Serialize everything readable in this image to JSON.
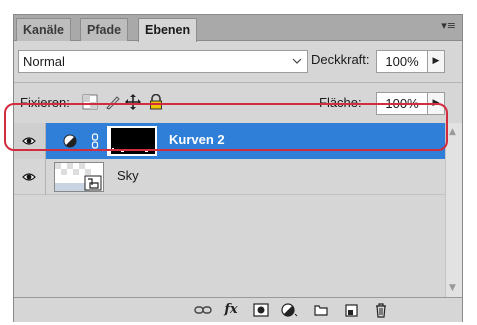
{
  "tabs": [
    {
      "label": "Kanäle"
    },
    {
      "label": "Pfade"
    },
    {
      "label": "Ebenen"
    }
  ],
  "blend_mode": {
    "value": "Normal"
  },
  "opacity": {
    "label": "Deckkraft:",
    "value": "100%"
  },
  "lock": {
    "label": "Fixieren:"
  },
  "fill": {
    "label": "Fläche:",
    "value": "100%"
  },
  "layers": [
    {
      "name": "Kurven 2",
      "selected": true,
      "type": "adjustment-curves"
    },
    {
      "name": "Sky",
      "selected": false,
      "type": "smart-object"
    }
  ],
  "colors": {
    "selection": "#2f7ed8",
    "highlight_frame": "#d22c3f",
    "panel_bg": "#d6d6d6"
  },
  "bottom_toolbar": [
    {
      "icon": "link-layers-icon"
    },
    {
      "icon": "fx-icon",
      "text": "fx"
    },
    {
      "icon": "add-mask-icon"
    },
    {
      "icon": "adjustment-layer-icon"
    },
    {
      "icon": "new-group-icon"
    },
    {
      "icon": "new-layer-icon"
    },
    {
      "icon": "trash-icon"
    }
  ]
}
